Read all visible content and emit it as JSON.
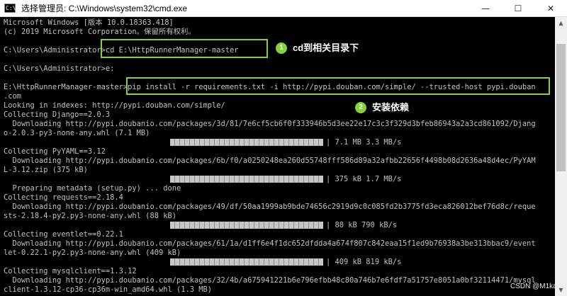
{
  "window": {
    "icon_text": "C:\\",
    "title": "选择管理员: C:\\Windows\\system32\\cmd.exe",
    "minimize": "—",
    "maximize": "☐",
    "close": "✕"
  },
  "console": {
    "lines": [
      "Microsoft Windows [版本 10.0.18363.418]",
      "(c) 2019 Microsoft Corporation。保留所有权利。",
      "",
      "C:\\Users\\Administrator>cd E:\\HttpRunnerManager-master",
      "",
      "C:\\Users\\Administrator>e:",
      "",
      "E:\\HttpRunnerManager-master>pip install -r requirements.txt -i http://pypi.douban.com/simple/ --trusted-host pypi.douban",
      ".com",
      "Looking in indexes: http://pypi.douban.com/simple/",
      "Collecting Django==2.0.3",
      "  Downloading http://pypi.doubanio.com/packages/3d/81/7e6cf5cb6f0f333946b5d3ee22e17c3c3f329d3bfeb86943a2a3cd861092/Djang",
      "o-2.0.3-py3-none-any.whl (7.1 MB)",
      "",
      "Collecting PyYAML==3.12",
      "  Downloading http://pypi.doubanio.com/packages/6b/f0/a0250248ea260d55748fff586d89a32afbb22656f4498b08d2636a48d4ec/PyYAM",
      "L-3.12.zip (375 kB)",
      "",
      "  Preparing metadata (setup.py) ... done",
      "Collecting requests==2.18.4",
      "  Downloading http://pypi.doubanio.com/packages/49/df/50aa1999ab9bde74656c2919d9c0c085fd2b3775fd3eca826012bef76d8c/reque",
      "sts-2.18.4-py2.py3-none-any.whl (88 kB)",
      "",
      "Collecting eventlet==0.22.1",
      "  Downloading http://pypi.doubanio.com/packages/61/1a/d1ff6e4f1dc652dfdda4a674f807c842eaa15f1ed9b76938a3be313bbac9/event",
      "let-0.22.1-py2.py3-none-any.whl (409 kB)",
      "",
      "Collecting mysqlclient==1.3.12",
      "  Downloading http://pypi.doubanio.com/packages/32/4b/a675941221b6e796efbb48c80a746b7e6fdf7a51757e8051a0bf32114471/mysql",
      "client-1.3.12-cp36-cp36m-win_amd64.whl (1.3 MB)"
    ],
    "progress": [
      {
        "text": "| 7.1 MB 3.3 MB/s",
        "fraction": 1.0
      },
      {
        "text": "| 375 kB 1.7 MB/s",
        "fraction": 1.0
      },
      {
        "text": "| 88 kB 790 kB/s",
        "fraction": 1.0
      },
      {
        "text": "| 409 kB 819 kB/s",
        "fraction": 1.0
      }
    ]
  },
  "annotations": [
    {
      "number": "1",
      "text": "cd到相关目录下"
    },
    {
      "number": "2",
      "text": "安装依赖"
    }
  ],
  "scrollbar": {
    "up": "▲",
    "down": "▼"
  },
  "watermark": "CSDN @M1kasal",
  "colors": {
    "console_bg": "#000000",
    "console_text": "#c0c0c0",
    "annotation": "#86d23a"
  }
}
